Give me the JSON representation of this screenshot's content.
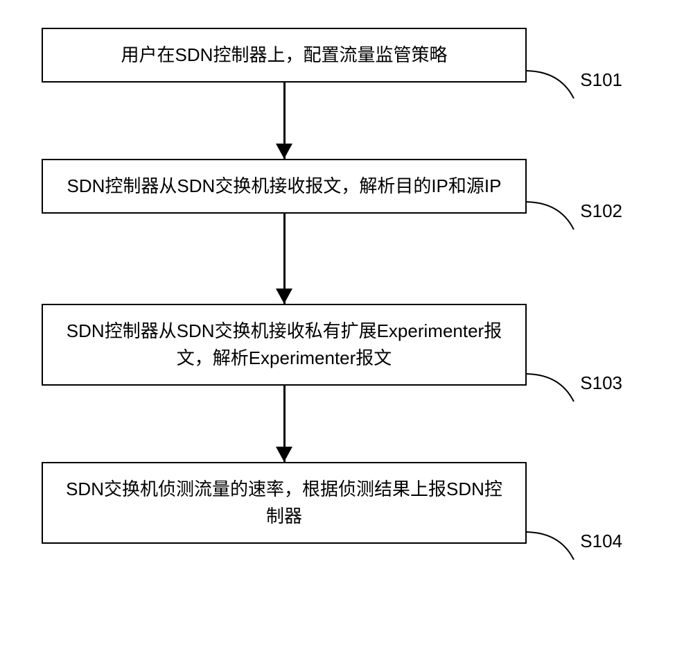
{
  "flowchart": {
    "steps": [
      {
        "text": "用户在SDN控制器上，配置流量监管策略",
        "label": "S101"
      },
      {
        "text": "SDN控制器从SDN交换机接收报文，解析目的IP和源IP",
        "label": "S102"
      },
      {
        "text": "SDN控制器从SDN交换机接收私有扩展Experimenter报文，解析Experimenter报文",
        "label": "S103"
      },
      {
        "text": "SDN交换机侦测流量的速率，根据侦测结果上报SDN控制器",
        "label": "S104"
      }
    ]
  }
}
